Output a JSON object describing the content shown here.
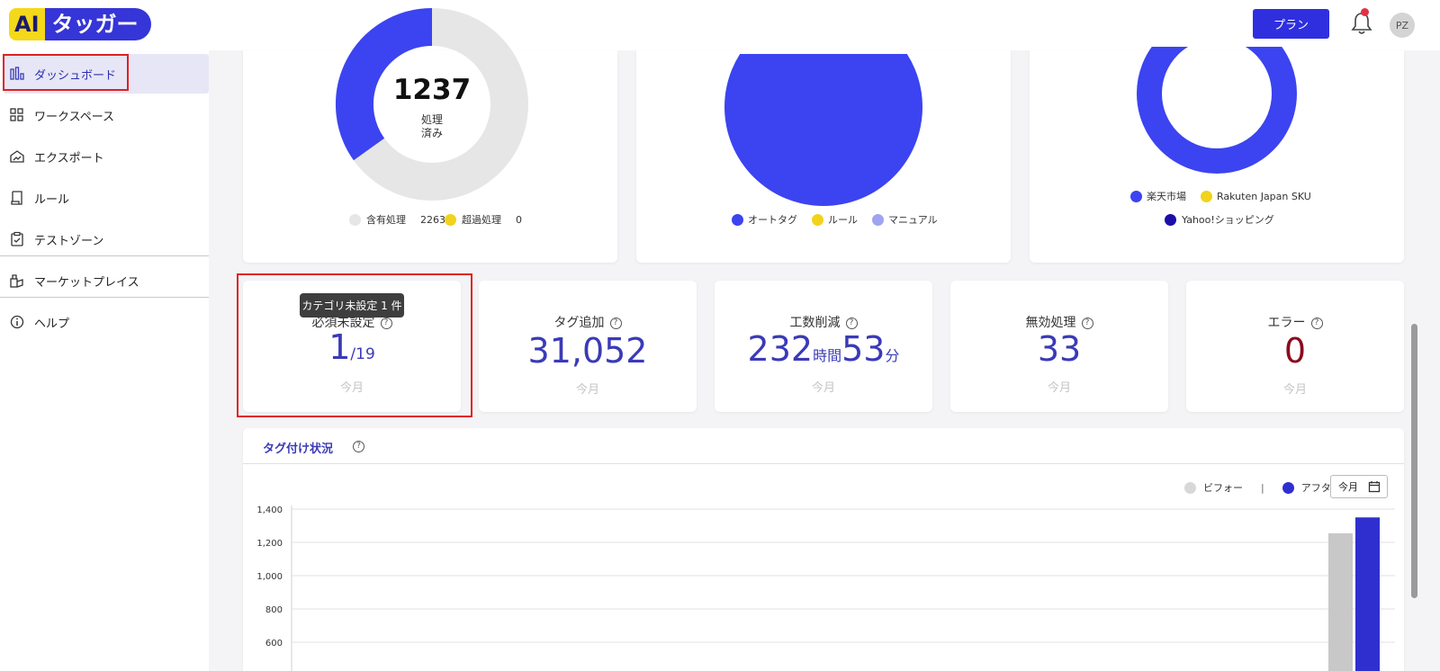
{
  "header": {
    "logo_ai": "AI",
    "logo_name": "タッガー",
    "plan_label": "プラン",
    "avatar_initials": "PZ"
  },
  "sidebar": {
    "items": [
      {
        "label": "ダッシュボード",
        "icon": "bar-chart-icon",
        "active": true
      },
      {
        "label": "ワークスペース",
        "icon": "grid-icon"
      },
      {
        "label": "エクスポート",
        "icon": "export-icon"
      },
      {
        "label": "ルール",
        "icon": "rule-document-icon"
      },
      {
        "label": "テストゾーン",
        "icon": "clipboard-check-icon"
      },
      {
        "label": "マーケットプレイス",
        "icon": "marketplace-icon"
      },
      {
        "label": "ヘルプ",
        "icon": "info-icon"
      }
    ]
  },
  "donut1": {
    "center_value": "1237",
    "center_label_1": "処理",
    "center_label_2": "済み",
    "legend": [
      {
        "label": "含有処理",
        "value": "2263",
        "color": "#e6e6e6"
      },
      {
        "label": "超過処理",
        "value": "0",
        "color": "#f2d31b"
      }
    ]
  },
  "pie2": {
    "legend": [
      {
        "label": "オートタグ",
        "color": "#3b44f0"
      },
      {
        "label": "ルール",
        "color": "#f2d31b"
      },
      {
        "label": "マニュアル",
        "color": "#9ea4f0"
      }
    ]
  },
  "donut3": {
    "legend": [
      {
        "label": "楽天市場",
        "color": "#3b44f0"
      },
      {
        "label": "Rakuten Japan SKU",
        "color": "#f2d31b"
      },
      {
        "label": "Yahoo!ショッピング",
        "color": "#1d0ea8"
      }
    ]
  },
  "stats": [
    {
      "title": "必須未設定",
      "value": "1",
      "suffix": "/19",
      "sub": "今月",
      "color": "#3a3ab8"
    },
    {
      "title": "タグ追加",
      "value": "31,052",
      "sub": "今月",
      "color": "#3a3ab8"
    },
    {
      "title": "工数削減",
      "hours": "232",
      "hours_unit": "時間",
      "minutes": "53",
      "minutes_unit": "分",
      "sub": "今月",
      "color": "#3a3ab8"
    },
    {
      "title": "無効処理",
      "value": "33",
      "sub": "今月",
      "color": "#3a3ab8"
    },
    {
      "title": "エラー",
      "value": "0",
      "sub": "今月",
      "color": "#8a0a1e"
    }
  ],
  "tooltip": "カテゴリ未設定 1 件",
  "tagging": {
    "title": "タグ付け状況",
    "legend_before": "ビフォー",
    "legend_separator": "|",
    "legend_after": "アフター",
    "period": "今月"
  },
  "chart_data": {
    "type": "bar",
    "title": "",
    "series": [
      {
        "name": "ビフォー",
        "values": [
          1255
        ],
        "color": "#c8c8c8"
      },
      {
        "name": "アフター",
        "values": [
          1350
        ],
        "color": "#2f2fd0"
      }
    ],
    "yticks": [
      "1,400",
      "1,200",
      "1,000",
      "800",
      "600"
    ],
    "ytick_values": [
      1400,
      1200,
      1000,
      800,
      600
    ],
    "ylim": [
      600,
      1400
    ],
    "grid": true
  }
}
